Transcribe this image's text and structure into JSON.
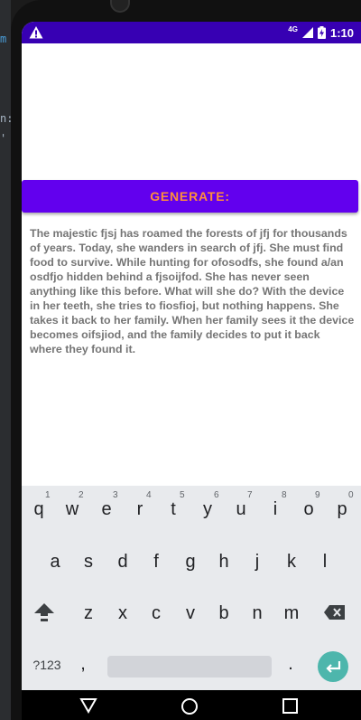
{
  "left_bezel": {
    "fragment_top": "m",
    "fragment_mid": "n:",
    "fragment_tick": "'"
  },
  "status_bar": {
    "alert_icon": "warning-icon",
    "network": "4G",
    "time": "1:10"
  },
  "generate_button": {
    "label": "GENERATE:"
  },
  "story": {
    "text": "The majestic fjsj has roamed the forests of jfj for thousands of years. Today, she wanders in search of jfj. She must find food to survive. While hunting for ofosodfs, she found a/an osdfjo hidden behind a fjsoijfod. She has never seen anything like this before. What will she do? With the device in her teeth, she tries to fiosfioj, but nothing happens. She takes it back to her family. When her family sees it the device becomes oifsjiod, and the family decides to put it back where they found it."
  },
  "keyboard": {
    "row1": [
      "q",
      "w",
      "e",
      "r",
      "t",
      "y",
      "u",
      "i",
      "o",
      "p"
    ],
    "row1_numbers": [
      "1",
      "2",
      "3",
      "4",
      "5",
      "6",
      "7",
      "8",
      "9",
      "0"
    ],
    "row2": [
      "a",
      "s",
      "d",
      "f",
      "g",
      "h",
      "j",
      "k",
      "l"
    ],
    "row3": [
      "z",
      "x",
      "c",
      "v",
      "b",
      "n",
      "m"
    ],
    "symbols_key": "?123",
    "comma_key": ",",
    "period_key": ".",
    "shift_icon": "shift-arrow-icon",
    "backspace_icon": "backspace-icon",
    "enter_icon": "enter-arrow-icon"
  },
  "nav_bar": {
    "back_icon": "back-triangle-icon",
    "home_icon": "home-circle-icon",
    "recents_icon": "recents-square-icon"
  },
  "colors": {
    "status_bar": "#3700b3",
    "button": "#6200ee",
    "button_text": "#ff8f3a",
    "story_text": "#757575",
    "enter_key": "#4db6ac"
  }
}
